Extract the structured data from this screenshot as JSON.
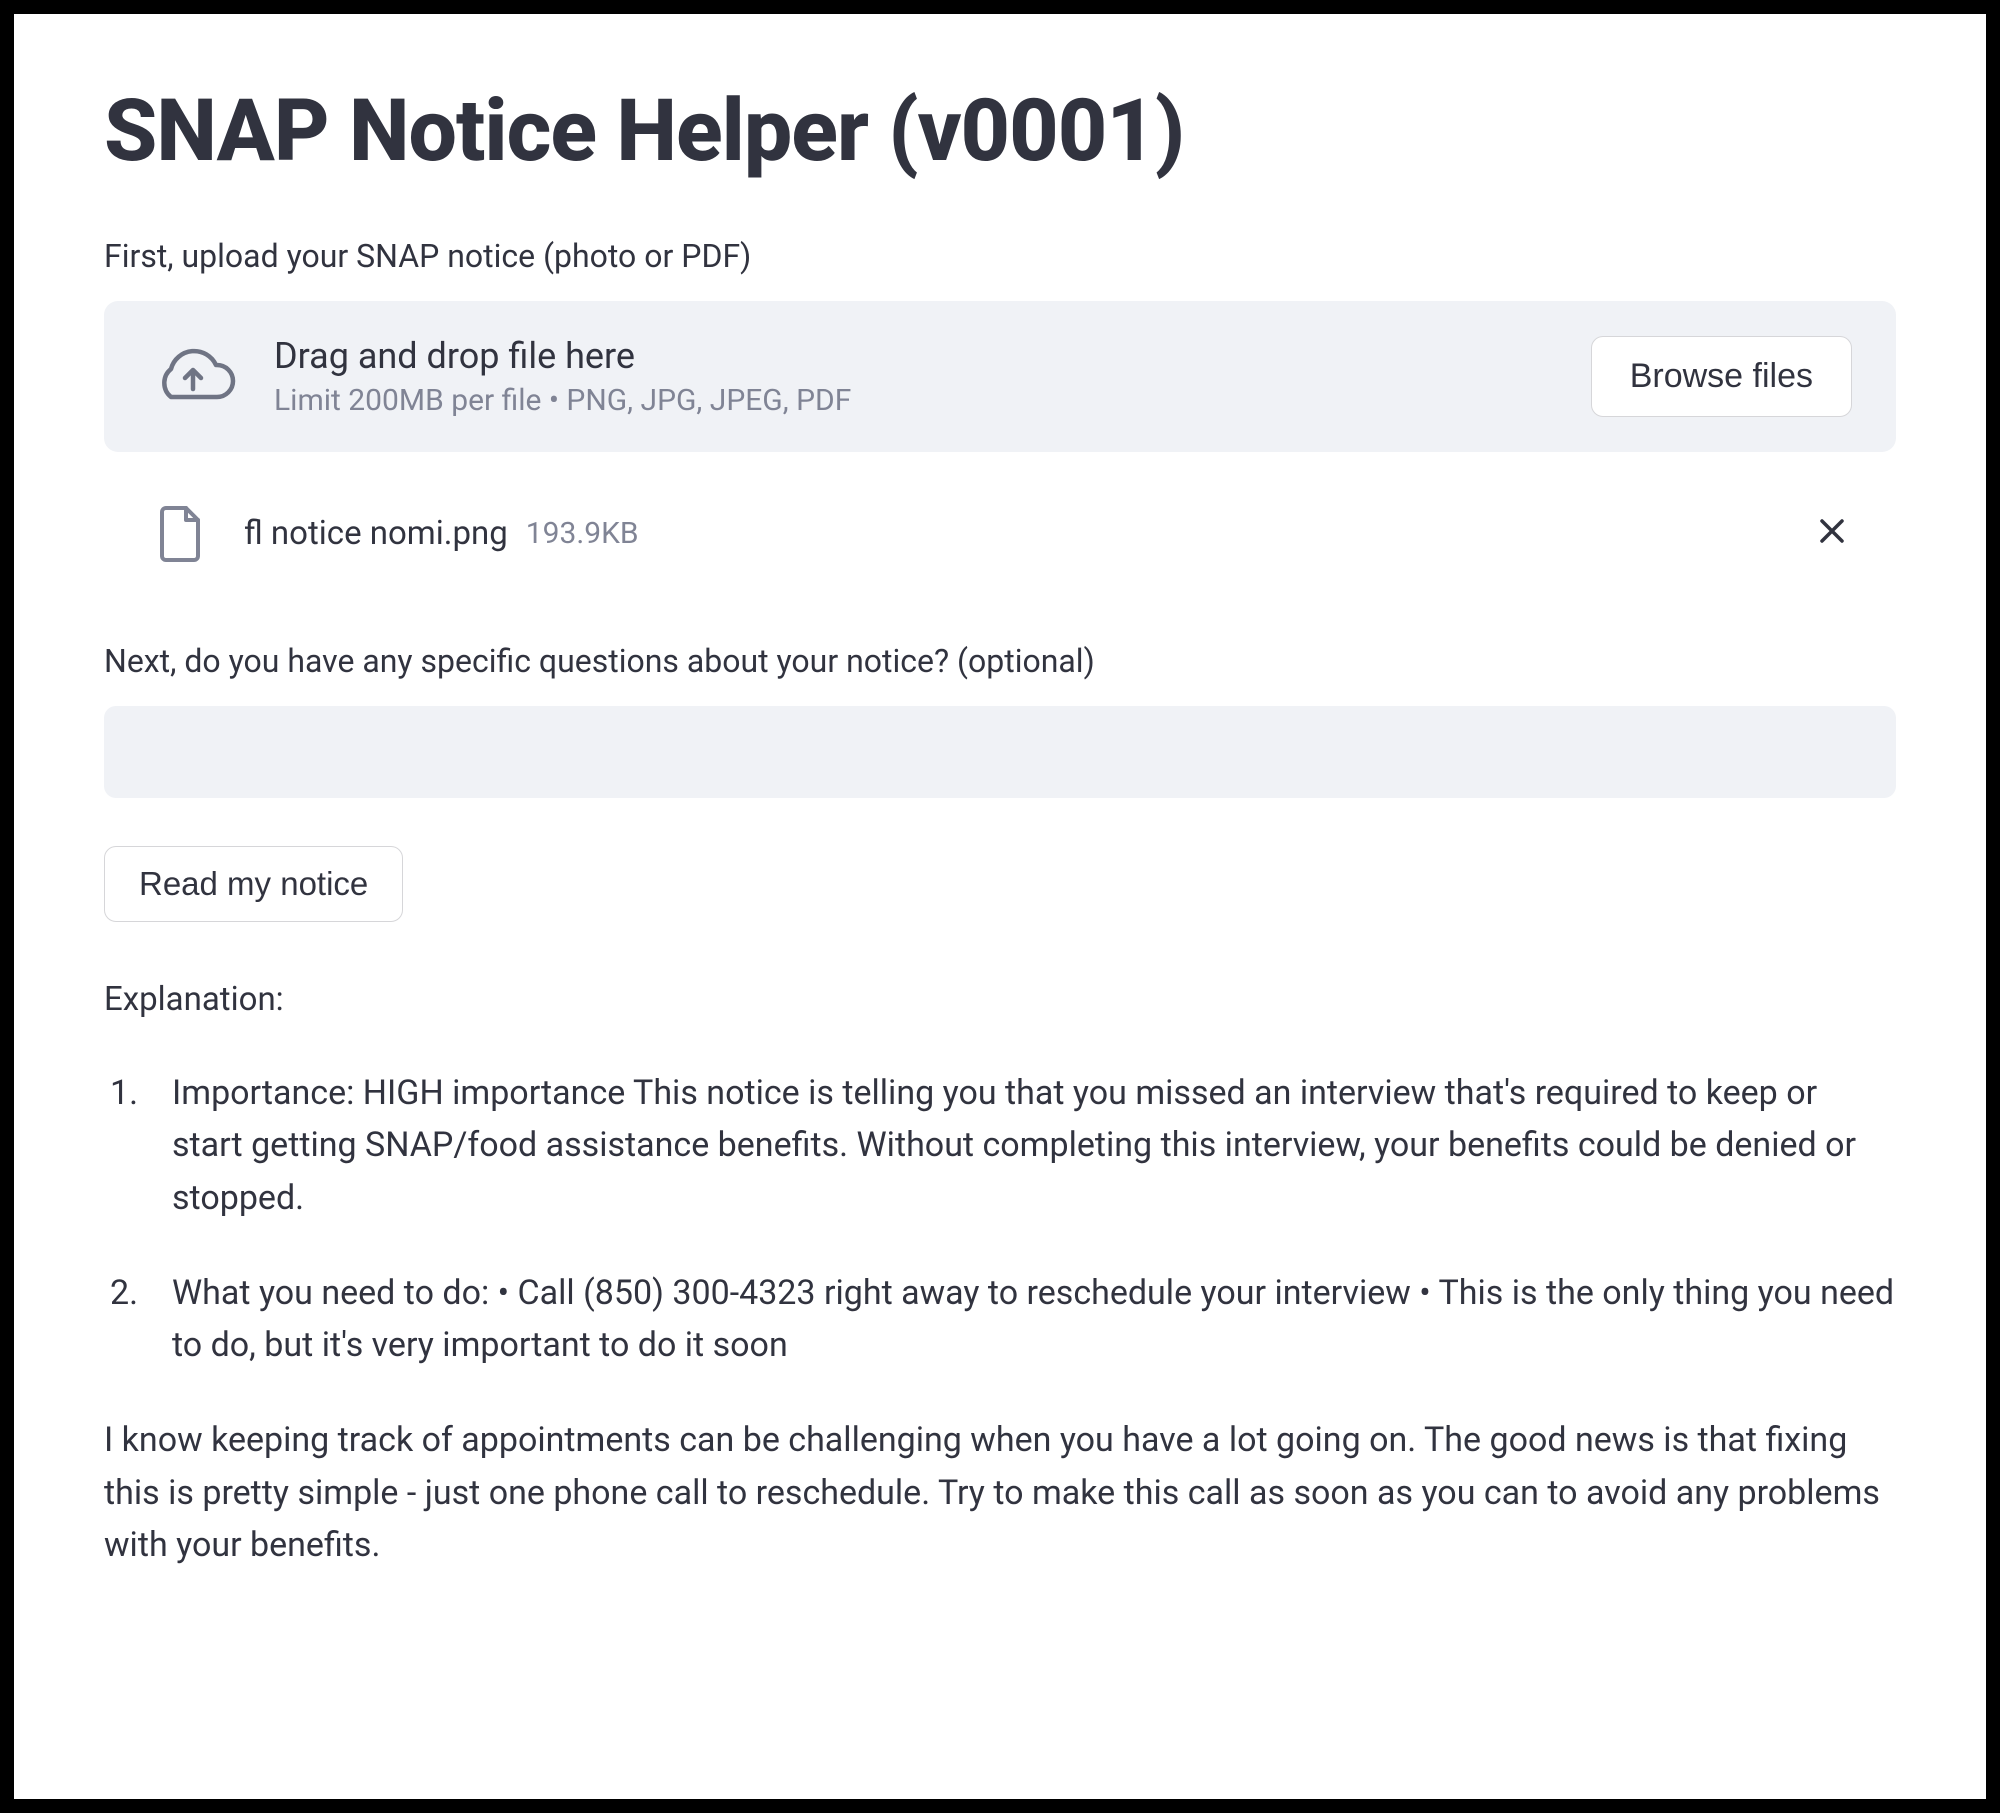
{
  "title": "SNAP Notice Helper (v0001)",
  "step1_label": "First, upload your SNAP notice (photo or PDF)",
  "dropzone": {
    "title": "Drag and drop file here",
    "subtitle": "Limit 200MB per file • PNG, JPG, JPEG, PDF",
    "browse_label": "Browse files"
  },
  "uploaded_file": {
    "name": "fl notice nomi.png",
    "size": "193.9KB"
  },
  "step2_label": "Next, do you have any specific questions about your notice? (optional)",
  "question_input": {
    "value": "",
    "placeholder": ""
  },
  "action_button_label": "Read my notice",
  "explanation_label": "Explanation:",
  "explanation_items": [
    "Importance: HIGH importance This notice is telling you that you missed an interview that's required to keep or start getting SNAP/food assistance benefits. Without completing this interview, your benefits could be denied or stopped.",
    "What you need to do: • Call (850) 300-4323 right away to reschedule your interview • This is the only thing you need to do, but it's very important to do it soon"
  ],
  "closing_text": "I know keeping track of appointments can be challenging when you have a lot going on. The good news is that fixing this is pretty simple - just one phone call to reschedule. Try to make this call as soon as you can to avoid any problems with your benefits."
}
